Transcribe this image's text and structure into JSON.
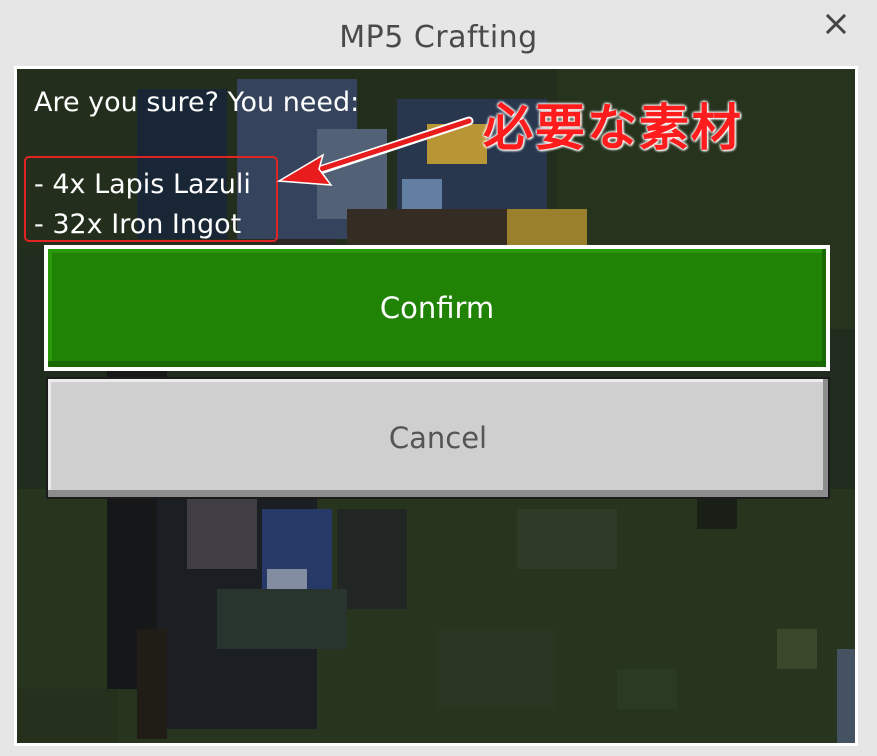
{
  "window": {
    "title": "MP5 Crafting",
    "close_icon": "close-icon"
  },
  "dialog": {
    "question": "Are you sure? You need:",
    "requirements": [
      "- 4x Lapis Lazuli",
      "- 32x Iron Ingot"
    ],
    "confirm_label": "Confirm",
    "cancel_label": "Cancel"
  },
  "annotation": {
    "text": "必要な素材",
    "color": "#ff1c1c"
  },
  "colors": {
    "confirm_bg": "#218306",
    "cancel_bg": "#cfcfcf",
    "panel_border": "#ffffff",
    "window_bg": "#e6e6e6"
  }
}
